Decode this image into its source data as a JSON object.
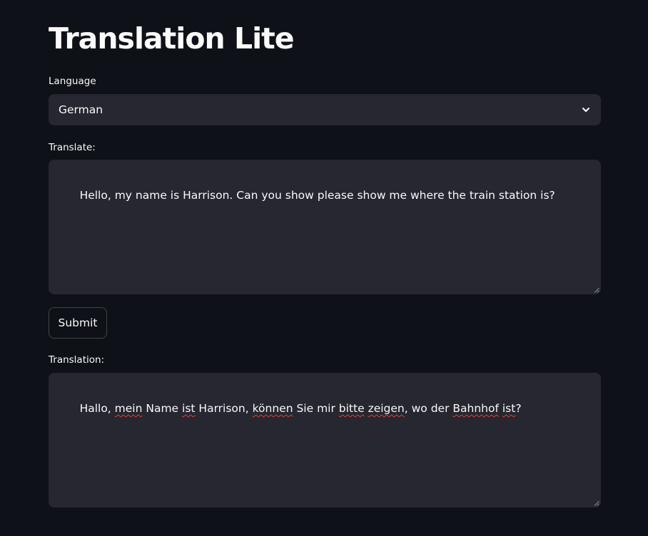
{
  "app": {
    "title": "Translation Lite"
  },
  "language": {
    "label": "Language",
    "selected": "German"
  },
  "translate": {
    "label": "Translate:",
    "value": "Hello, my name is Harrison. Can you show please show me where the train station is?"
  },
  "submit": {
    "label": "Submit"
  },
  "translation": {
    "label": "Translation:",
    "parts": [
      {
        "text": "Hallo, ",
        "flagged": false
      },
      {
        "text": "mein",
        "flagged": true
      },
      {
        "text": " Name ",
        "flagged": false
      },
      {
        "text": "ist",
        "flagged": true
      },
      {
        "text": " Harrison, ",
        "flagged": false
      },
      {
        "text": "können",
        "flagged": true
      },
      {
        "text": " Sie mir ",
        "flagged": false
      },
      {
        "text": "bitte",
        "flagged": true
      },
      {
        "text": " ",
        "flagged": false
      },
      {
        "text": "zeigen",
        "flagged": true
      },
      {
        "text": ", wo der ",
        "flagged": false
      },
      {
        "text": "Bahnhof",
        "flagged": true
      },
      {
        "text": " ",
        "flagged": false
      },
      {
        "text": "ist",
        "flagged": true
      },
      {
        "text": "?",
        "flagged": false
      }
    ]
  },
  "icons": {
    "dropdown": "chevron-down-icon",
    "resize": "resize-grip-icon"
  },
  "colors": {
    "background": "#0e1117",
    "input_background": "#262730",
    "text": "#fafafa",
    "spellcheck": "#e0413a"
  }
}
